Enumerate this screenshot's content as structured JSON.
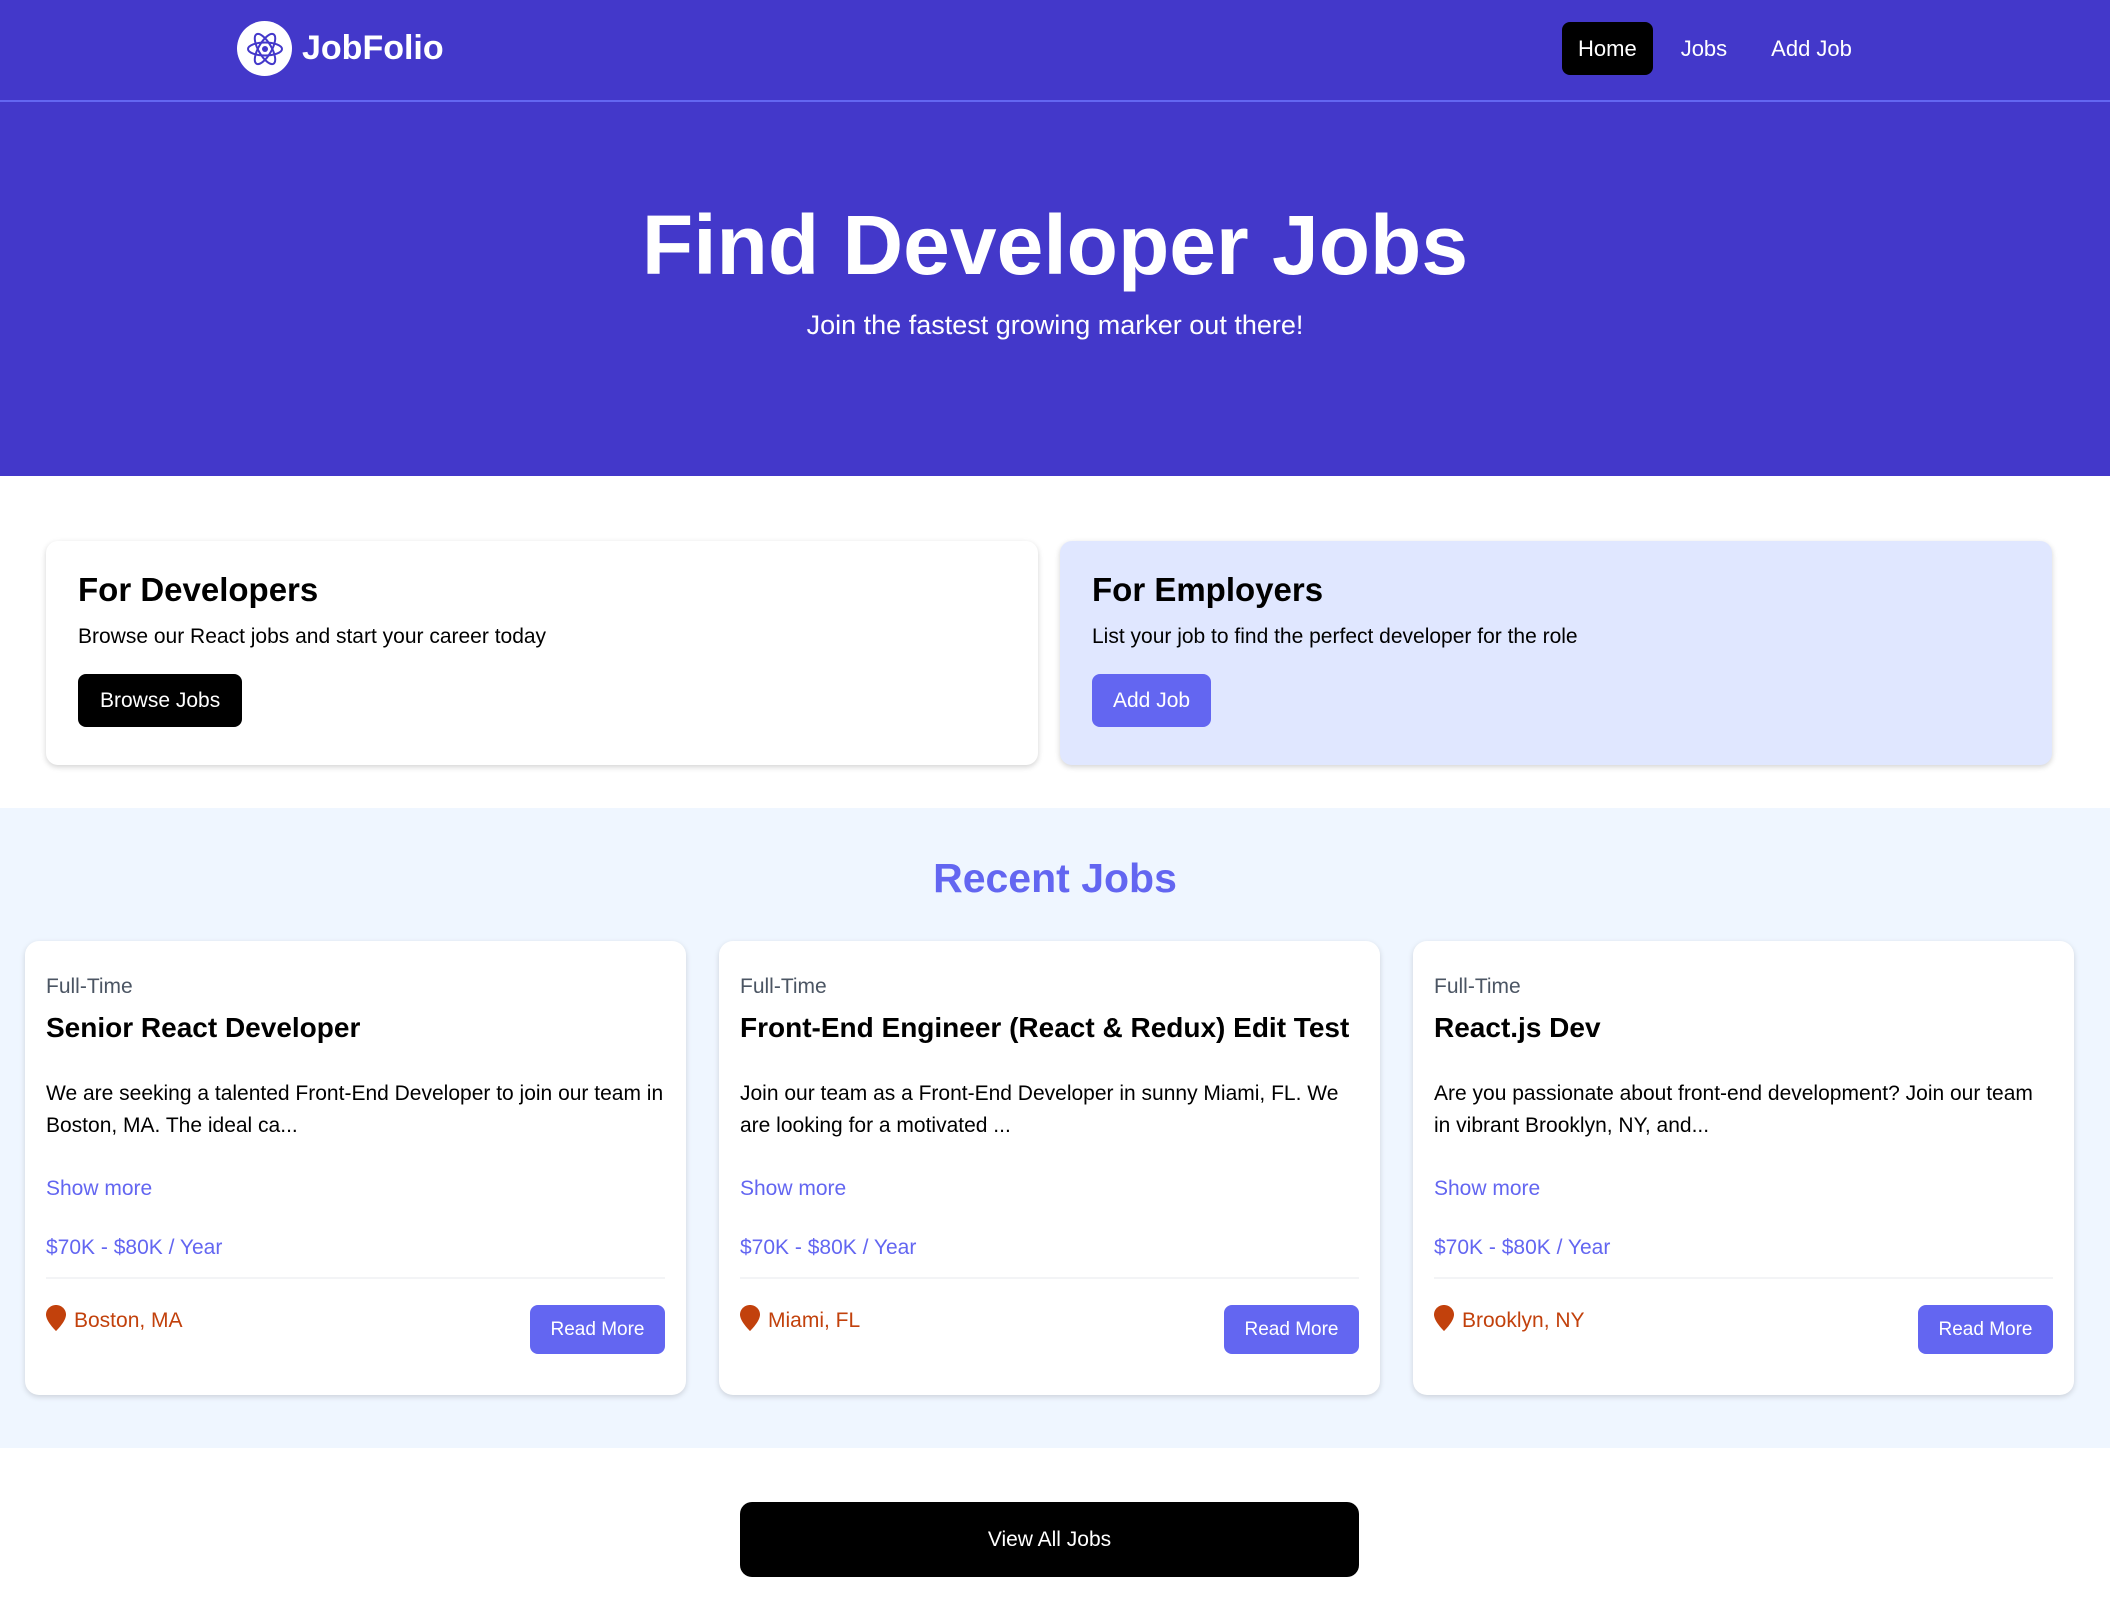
{
  "navbar": {
    "brand": "JobFolio",
    "links": [
      {
        "label": "Home",
        "active": true
      },
      {
        "label": "Jobs",
        "active": false
      },
      {
        "label": "Add Job",
        "active": false
      }
    ]
  },
  "hero": {
    "title": "Find Developer Jobs",
    "subtitle": "Join the fastest growing marker out there!"
  },
  "cards": {
    "developers": {
      "title": "For Developers",
      "text": "Browse our React jobs and start your career today",
      "button": "Browse Jobs"
    },
    "employers": {
      "title": "For Employers",
      "text": "List your job to find the perfect developer for the role",
      "button": "Add Job"
    }
  },
  "recent_jobs": {
    "title": "Recent Jobs",
    "jobs": [
      {
        "type": "Full-Time",
        "title": "Senior React Developer",
        "description": "We are seeking a talented Front-End Developer to join our team in Boston, MA. The ideal ca...",
        "show_more": "Show more",
        "salary": "$70K - $80K / Year",
        "location": "Boston, MA",
        "button": "Read More"
      },
      {
        "type": "Full-Time",
        "title": "Front-End Engineer (React & Redux) Edit Test",
        "description": "Join our team as a Front-End Developer in sunny Miami, FL. We are looking for a motivated ...",
        "show_more": "Show more",
        "salary": "$70K - $80K / Year",
        "location": "Miami, FL",
        "button": "Read More"
      },
      {
        "type": "Full-Time",
        "title": "React.js Dev",
        "description": "Are you passionate about front-end development? Join our team in vibrant Brooklyn, NY, and...",
        "show_more": "Show more",
        "salary": "$70K - $80K / Year",
        "location": "Brooklyn, NY",
        "button": "Read More"
      }
    ]
  },
  "view_all": "View All Jobs",
  "colors": {
    "primary": "#4338ca",
    "accent": "#6366f1",
    "location": "#c2410c",
    "employer_card": "#e0e7ff",
    "jobs_background": "#eff6ff"
  },
  "icons": {
    "logo": "atom-icon",
    "location": "map-pin-icon"
  }
}
